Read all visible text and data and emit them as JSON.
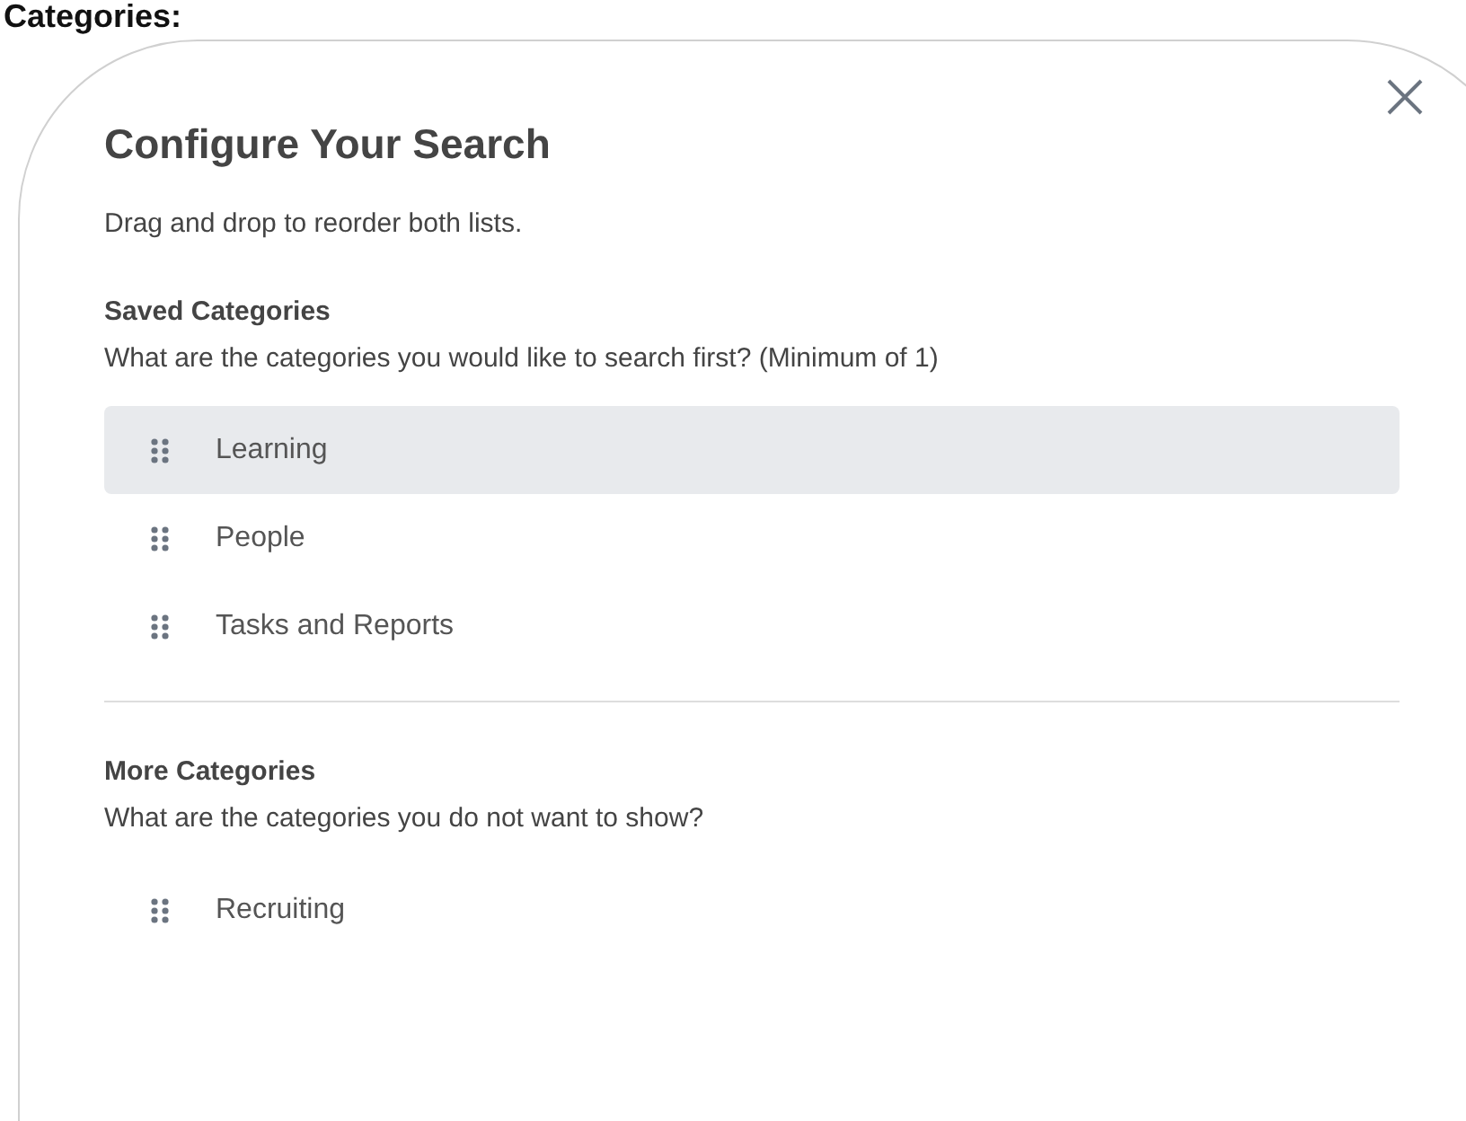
{
  "page_heading": "Categories:",
  "dialog": {
    "title": "Configure Your Search",
    "instruction": "Drag and drop to reorder both lists.",
    "sections": [
      {
        "title": "Saved Categories",
        "description": "What are the categories you would like to search first? (Minimum of 1)",
        "items": [
          {
            "label": "Learning",
            "selected": true
          },
          {
            "label": "People",
            "selected": false
          },
          {
            "label": "Tasks and Reports",
            "selected": false
          }
        ]
      },
      {
        "title": "More Categories",
        "description": "What are the categories you do not want to show?",
        "items": [
          {
            "label": "Recruiting",
            "selected": false
          }
        ]
      }
    ]
  }
}
